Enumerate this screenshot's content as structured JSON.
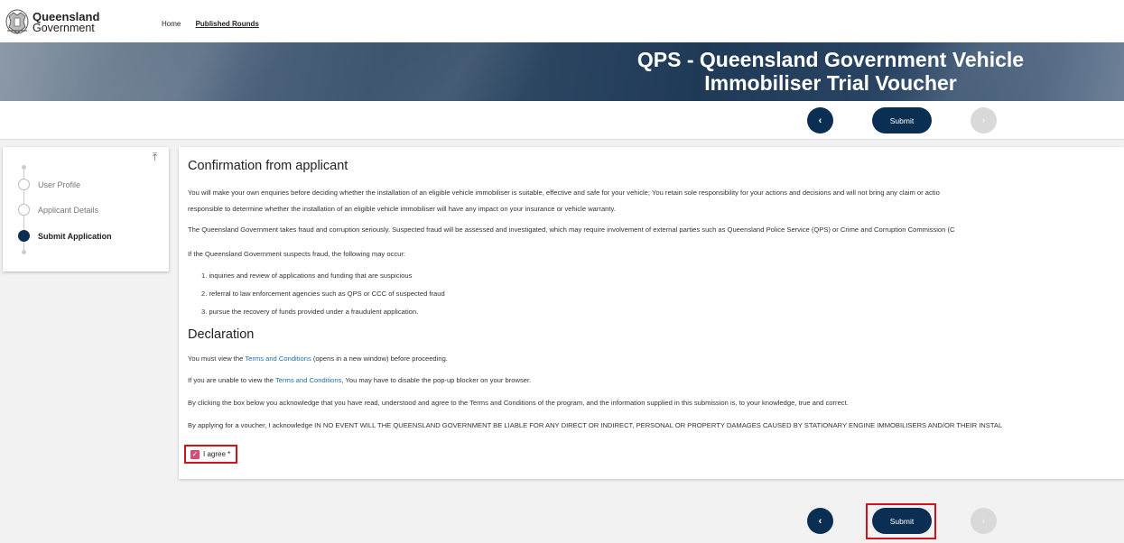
{
  "header": {
    "logo_line1": "Queensland",
    "logo_line2": "Government",
    "nav": [
      "Home",
      "Published Rounds"
    ],
    "active_nav": "Published Rounds"
  },
  "banner": {
    "title_line1": "QPS - Queensland Government Vehicle",
    "title_line2": "Immobiliser Trial Voucher"
  },
  "actions": {
    "back_icon": "chevron-left-icon",
    "back_glyph": "‹",
    "submit_label": "Submit",
    "next_icon": "chevron-right-icon",
    "next_glyph": "›"
  },
  "sidebar": {
    "collapse_glyph": "⤒",
    "steps": [
      {
        "label": "User Profile",
        "state": "complete"
      },
      {
        "label": "Applicant Details",
        "state": "complete"
      },
      {
        "label": "Submit Application",
        "state": "active"
      }
    ]
  },
  "content": {
    "confirmation_heading": "Confirmation from applicant",
    "para1_line1": "You will make your own enquiries before deciding whether the installation of an eligible vehicle immobiliser is suitable, effective and safe for your vehicle;  You retain sole responsibility for your actions and decisions and will not bring any claim or actio",
    "para1_line2": "responsible to determine whether the installation of an eligible vehicle immobiliser will have any impact on your insurance or vehicle warranty.",
    "para2": "The Queensland Government takes fraud and corruption seriously. Suspected fraud will be assessed and investigated, which may require involvement of external parties such as Queensland Police Service (QPS) or Crime and Corruption Commission (C",
    "para3": "If the Queensland Government suspects fraud, the following may occur:",
    "list": [
      "1. inquiries and review of applications and funding that are suspicious",
      "2. referral to law enforcement agencies such as QPS or CCC of suspected fraud",
      "3. pursue the recovery of funds provided under a fraudulent application."
    ],
    "declaration_heading": "Declaration",
    "decl1_before": "You must view the ",
    "decl1_link": "Terms and Conditions",
    "decl1_after": " (opens in a new window) before proceeding.",
    "decl2_before": "If you are unable to view the ",
    "decl2_link": "Terms and Conditions",
    "decl2_after": ", You may have to disable the pop-up blocker on your browser.",
    "decl3": "By clicking the box below you acknowledge that you have read, understood and agree to the Terms and Conditions of the program, and the information supplied in this submission is, to your knowledge, true and correct.",
    "decl4": "By applying for a voucher, I acknowledge IN NO EVENT WILL THE QUEENSLAND GOVERNMENT BE LIABLE FOR ANY DIRECT OR INDIRECT, PERSONAL OR PROPERTY DAMAGES CAUSED BY STATIONARY ENGINE IMMOBILISERS AND/OR THEIR INSTAL",
    "agree_label": "I agree *",
    "agree_checked": true,
    "check_glyph": "✓"
  },
  "colors": {
    "primary": "#0b2f52",
    "link": "#1f6fa8",
    "highlight": "#d0121b",
    "checkbox": "#d74d73"
  }
}
